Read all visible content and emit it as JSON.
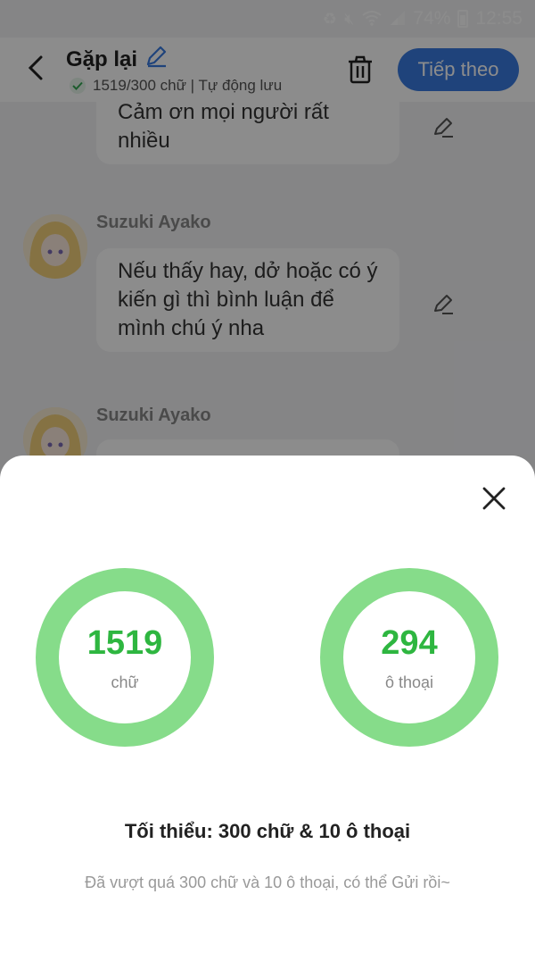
{
  "status_bar": {
    "battery": "74%",
    "time": "12:55"
  },
  "header": {
    "title": "Gặp lại",
    "subtitle": "1519/300 chữ | Tự động lưu",
    "next_label": "Tiếp theo"
  },
  "messages": [
    {
      "sender": "",
      "text": "Cảm ơn mọi người rất nhiều"
    },
    {
      "sender": "Suzuki Ayako",
      "text": "Nếu thấy hay, dở hoặc có ý kiến gì thì bình luận để mình chú ý nha"
    },
    {
      "sender": "Suzuki Ayako",
      "text": ""
    }
  ],
  "sheet": {
    "words_count": "1519",
    "words_unit": "chữ",
    "dialogs_count": "294",
    "dialogs_unit": "ô thoại",
    "minimum": "Tối thiểu: 300 chữ & 10 ô thoại",
    "hint": "Đã vượt quá 300 chữ và 10 ô thoại, có thể Gửi rồi~"
  },
  "colors": {
    "accent": "#3a7be0",
    "ring": "#86dc8a",
    "ring_text": "#2eb640"
  }
}
